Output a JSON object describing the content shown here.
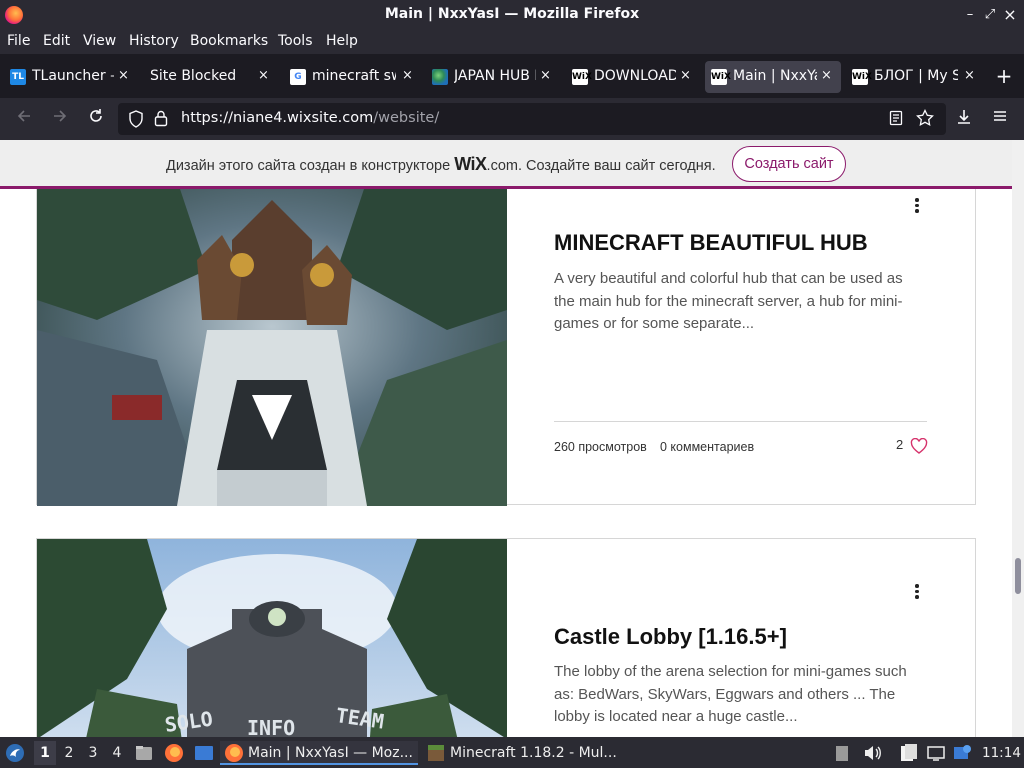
{
  "window": {
    "title": "Main | NxxYasI — Mozilla Firefox",
    "minimize": "–",
    "maximize": "⤢",
    "close": "×"
  },
  "menu": [
    "File",
    "Edit",
    "View",
    "History",
    "Bookmarks",
    "Tools",
    "Help"
  ],
  "tabs": [
    {
      "label": "TLauncher – ",
      "icon": "tlauncher-icon",
      "badge": "TL"
    },
    {
      "label": "Site Blocked",
      "icon": "none",
      "badge": ""
    },
    {
      "label": "minecraft sw",
      "icon": "google-icon",
      "badge": "G"
    },
    {
      "label": "JAPAN HUB L",
      "icon": "globe-icon",
      "badge": ""
    },
    {
      "label": "DOWNLOAD",
      "icon": "wix-icon",
      "badge": "WiX"
    },
    {
      "label": "Main | NxxYa",
      "icon": "wix-icon",
      "badge": "WiX",
      "active": true
    },
    {
      "label": "БЛОГ | My S",
      "icon": "wix-icon",
      "badge": "WiX"
    }
  ],
  "tab_close": "×",
  "new_tab": "+",
  "url": {
    "host": "https://niane4.wixsite.com",
    "path": "/website/"
  },
  "wix_banner": {
    "text_before": "Дизайн этого сайта создан в конструкторе ",
    "logo": "WiX",
    "text_after": ".com. Создайте ваш сайт сегодня.",
    "button": "Создать сайт"
  },
  "posts": [
    {
      "title": "MINECRAFT BEAUTIFUL HUB",
      "excerpt": "A very beautiful and colorful hub that can be used as the main hub for the minecraft server, a hub for mini-games or for some separate...",
      "views": "260 просмотров",
      "comments": "0 комментариев",
      "likes": "2"
    },
    {
      "title": "Castle Lobby [1.16.5+]",
      "excerpt": "The lobby of the arena selection for mini-games such as: BedWars, SkyWars, Eggwars and others ... The lobby is located near a huge castle...",
      "image_text_left": "SOLO",
      "image_text_center": "INFO",
      "image_text_right": "TEAM"
    }
  ],
  "taskbar": {
    "workspaces": [
      "1",
      "2",
      "3",
      "4"
    ],
    "items": [
      {
        "label": "Main | NxxYasI — Moz...",
        "active": true
      },
      {
        "label": "Minecraft 1.18.2 - Mul..."
      }
    ],
    "clock": "11:14"
  },
  "colors": {
    "accent": "#8b1a6b",
    "browser_dark": "#2b2a33"
  }
}
